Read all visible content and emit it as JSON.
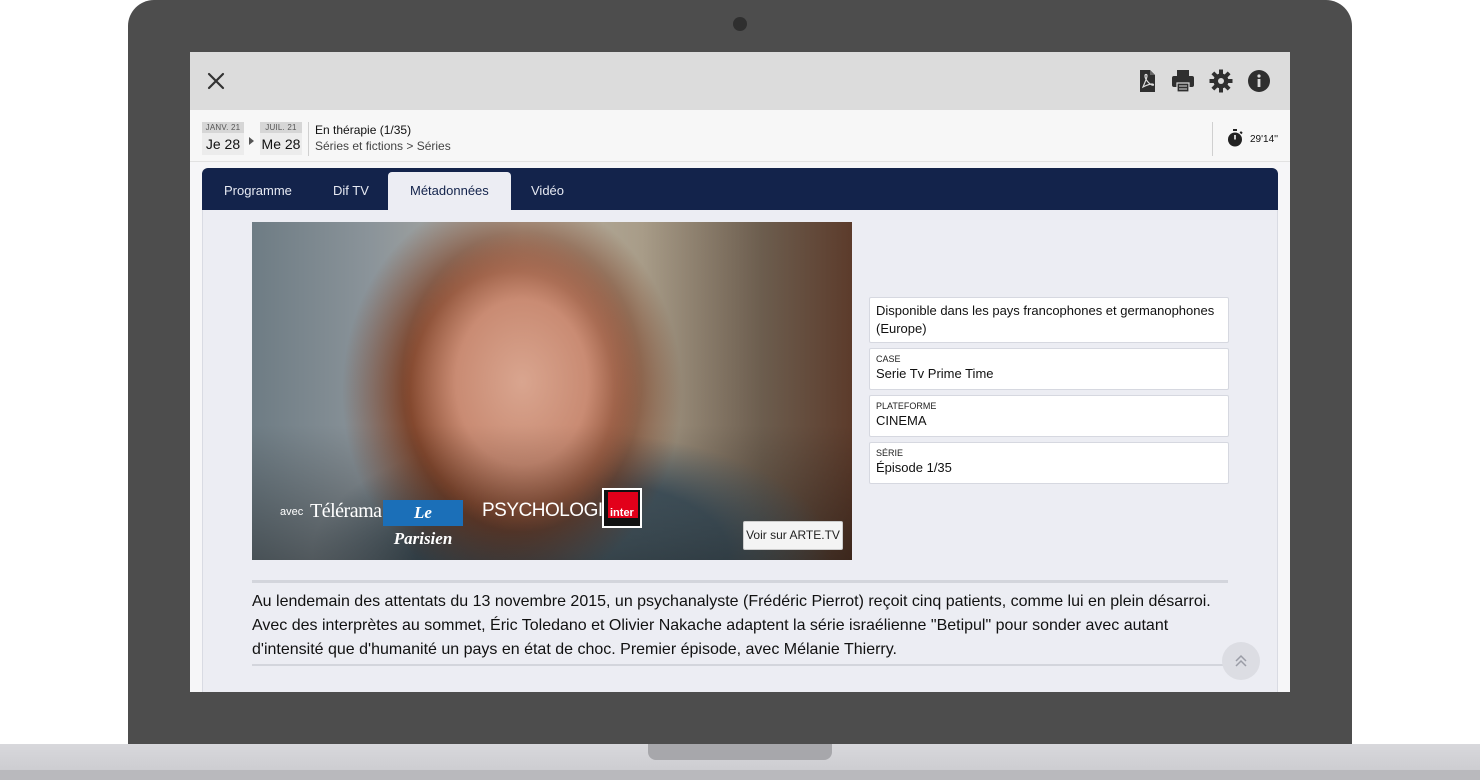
{
  "toolbar": {
    "close_icon": "close-icon",
    "icons": [
      "pdf-icon",
      "print-icon",
      "gear-icon",
      "info-icon"
    ]
  },
  "schedule": {
    "start": {
      "month": "JANV. 21",
      "day": "Je 28"
    },
    "end": {
      "month": "JUIL. 21",
      "day": "Me 28"
    },
    "title": "En thérapie (1/35)",
    "category": "Séries et fictions > Séries",
    "duration": "29'14''"
  },
  "tabs": [
    {
      "label": "Programme",
      "active": false
    },
    {
      "label": "Dif TV",
      "active": false
    },
    {
      "label": "Métadonnées",
      "active": true
    },
    {
      "label": "Vidéo",
      "active": false
    }
  ],
  "media": {
    "partners_prefix": "avec",
    "partners": [
      "Télérama",
      "Le Parisien",
      "PSYCHOLOGIES",
      "inter"
    ],
    "arte_button": "Voir sur ARTE.TV"
  },
  "metadata": {
    "availability": "Disponible dans les pays francophones et germanophones (Europe)",
    "fields": [
      {
        "label": "CASE",
        "value": "Serie Tv Prime Time"
      },
      {
        "label": "PLATEFORME",
        "value": "CINEMA"
      },
      {
        "label": "SÉRIE",
        "value": "Épisode 1/35"
      }
    ]
  },
  "synopsis": "Au lendemain des attentats du 13 novembre 2015, un psychanalyste (Frédéric Pierrot) reçoit cinq patients, comme lui en plein désarroi. Avec des interprètes au sommet, Éric Toledano et Olivier Nakache adaptent la série israélienne \"Betipul\" pour sonder avec autant d'intensité que d'humanité un pays en état de choc. Premier épisode, avec Mélanie Thierry.",
  "colors": {
    "navy": "#13234b",
    "panel": "#ecedf3",
    "topbar": "#dcdcdc"
  }
}
